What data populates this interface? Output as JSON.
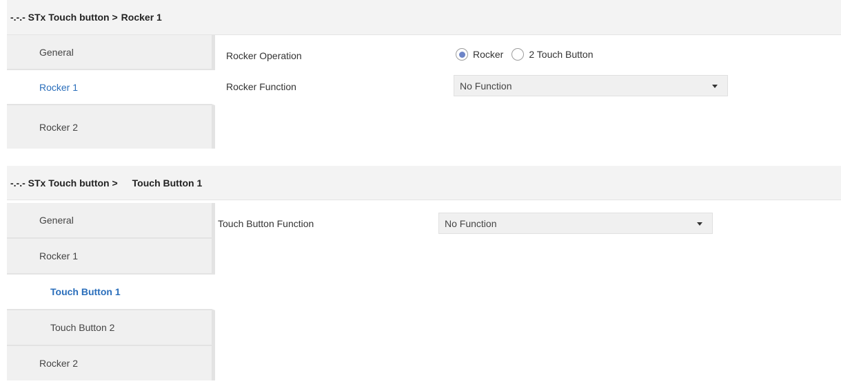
{
  "panel1": {
    "breadcrumb_prefix": "-.-.- STx Touch button >",
    "breadcrumb_current": "Rocker 1",
    "sidebar": [
      "General",
      "Rocker 1",
      "Rocker 2"
    ],
    "selected_index": 1,
    "rocker_operation_label": "Rocker Operation",
    "radio_options": [
      "Rocker",
      "2 Touch Button"
    ],
    "radio_selected": "Rocker",
    "rocker_function_label": "Rocker Function",
    "rocker_function_value": "No Function"
  },
  "panel2": {
    "breadcrumb_prefix": "-.-.- STx Touch button >",
    "breadcrumb_current": "Touch Button 1",
    "sidebar": [
      "General",
      "Rocker 1",
      "Touch Button 1",
      "Touch Button 2",
      "Rocker 2"
    ],
    "selected_index": 2,
    "touch_function_label": "Touch Button Function",
    "touch_function_value": "No Function"
  },
  "colors": {
    "accent": "#2a6ebb",
    "radio_dot": "#6d84c7",
    "header_bg": "#f3f3f3",
    "sidebar_bg": "#f0f0f0"
  },
  "icons": {
    "dropdown": "chevron-down-icon"
  }
}
